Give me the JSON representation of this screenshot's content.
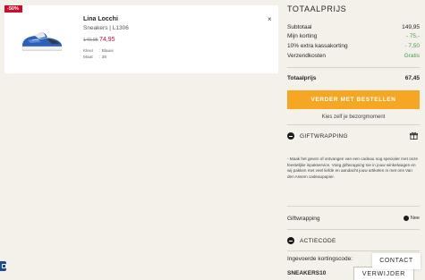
{
  "product": {
    "badge": "-50%",
    "brand": "Lina Locchi",
    "subtitle": "Sneakers | L1306",
    "price_old": "149,95",
    "price_new": "74,95",
    "attributes": [
      {
        "label": "Kleur",
        "value": ": Blauw"
      },
      {
        "label": "Maat",
        "value": ": 38"
      }
    ],
    "close": "×"
  },
  "summary": {
    "title": "TOTAALPRIJS",
    "rows": [
      {
        "label": "Subtotaal",
        "value": "149,95"
      },
      {
        "label": "Mijn korting",
        "value": "- 75,-"
      },
      {
        "label": "10% extra kassakorting",
        "value": "- 7,50"
      },
      {
        "label": "Verzendkosten",
        "value": "Gratis"
      }
    ],
    "total_label": "Totaalprijs",
    "total_value": "67,45",
    "cta": "VERDER MET BESTELLEN",
    "store_note": "Kies zelf je bezorgmoment"
  },
  "gift": {
    "title": "GIFTWRAPPING",
    "text_1": "- Maak het geven of ontvangen van een cadeau nog specialer met onze feestelijke inpakservice. Voeg ",
    "text_em": "giftwrapping",
    "text_2": " toe in jouw winkelwagen en wij pakken met veel liefde en aandacht jouw artikelen in met ons Van den Assem cadeaupapier.",
    "toggle_label": "Giftwrapping",
    "toggle_value": "Nee"
  },
  "coupon": {
    "title": "ACTIECODE",
    "label": "Ingevoerde kortingscode:",
    "code": "SNEAKERS10",
    "remove": "VERWIJDER"
  },
  "contact": "CONTACT",
  "colors": {
    "badge": "#c8102e",
    "cta": "#f5a623",
    "green": "#4b9b4e",
    "background": "#f4f1eb"
  }
}
